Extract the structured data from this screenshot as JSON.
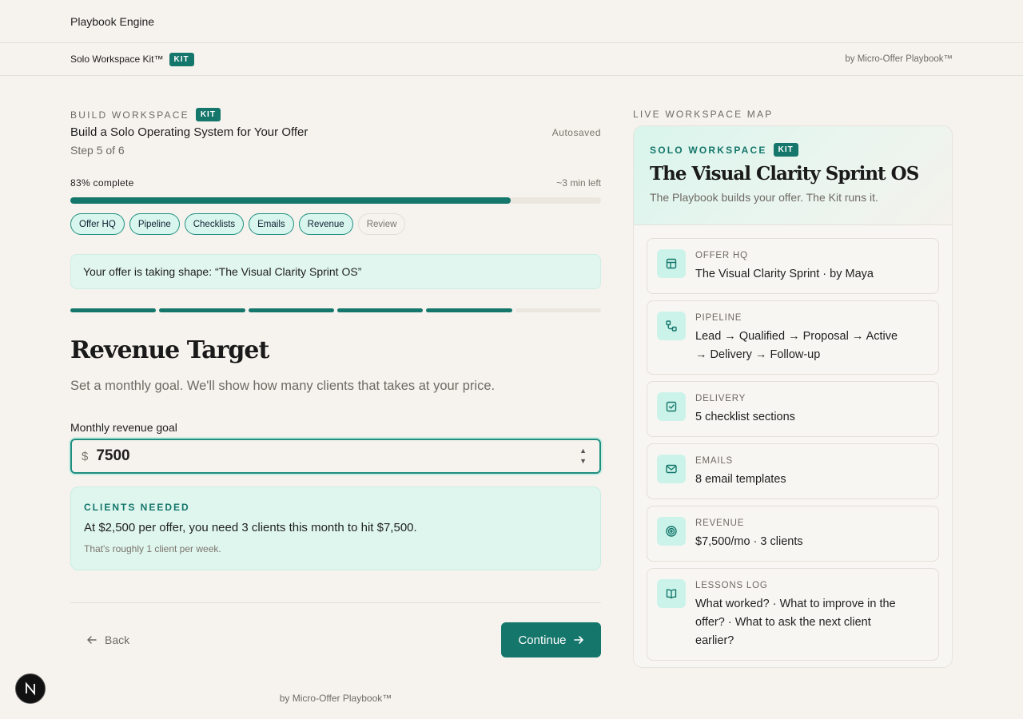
{
  "app": {
    "title": "Playbook Engine"
  },
  "subbar": {
    "kit_name": "Solo Workspace Kit™",
    "kit_badge": "KIT",
    "by": "by Micro-Offer Playbook™"
  },
  "step": {
    "eyebrow": "BUILD WORKSPACE",
    "eyebrow_badge": "KIT",
    "title": "Build a Solo Operating System for Your Offer",
    "autosaved": "Autosaved",
    "step_label": "Step 5 of 6",
    "progress_label": "83% complete",
    "progress_value": 0.83,
    "time_left": "~3 min left",
    "chips": [
      {
        "label": "Offer HQ",
        "done": true
      },
      {
        "label": "Pipeline",
        "done": true
      },
      {
        "label": "Checklists",
        "done": true
      },
      {
        "label": "Emails",
        "done": true
      },
      {
        "label": "Revenue",
        "done": true
      },
      {
        "label": "Review",
        "done": false
      }
    ],
    "notice": "Your offer is taking shape: “The Visual Clarity Sprint OS”",
    "segments_total": 6,
    "segments_done": 5
  },
  "section": {
    "title": "Revenue Target",
    "description": "Set a monthly goal. We'll show how many clients that takes at your price.",
    "field_label": "Monthly revenue goal",
    "currency": "$",
    "value": "7500",
    "clients": {
      "caption": "CLIENTS NEEDED",
      "message": "At $2,500 per offer, you need 3 clients this month to hit $7,500.",
      "note": "That's roughly 1 client per week."
    },
    "back_label": "Back",
    "continue_label": "Continue"
  },
  "footer": {
    "by": "by Micro-Offer Playbook™"
  },
  "side": {
    "heading": "LIVE WORKSPACE MAP",
    "eyebrow": "SOLO WORKSPACE",
    "eyebrow_badge": "KIT",
    "title": "The Visual Clarity Sprint OS",
    "tagline": "The Playbook builds your offer. The Kit runs it.",
    "cards": [
      {
        "icon": "layout-icon",
        "label": "OFFER HQ",
        "value": "The Visual Clarity Sprint · by Maya"
      },
      {
        "icon": "workflow-icon",
        "label": "PIPELINE",
        "value": "Lead → Qualified → Proposal → Active → Delivery → Follow-up"
      },
      {
        "icon": "checkbox-icon",
        "label": "DELIVERY",
        "value": "5 checklist sections"
      },
      {
        "icon": "mail-icon",
        "label": "EMAILS",
        "value": "8 email templates"
      },
      {
        "icon": "target-icon",
        "label": "REVENUE",
        "value": "$7,500/mo · 3 clients"
      },
      {
        "icon": "book-icon",
        "label": "LESSONS LOG",
        "value": "What worked? · What to improve in the offer? · What to ask the next client earlier?"
      }
    ]
  },
  "colors": {
    "accent": "#15766b",
    "accent_soft": "#dff6ef",
    "background": "#f6f3ee"
  }
}
